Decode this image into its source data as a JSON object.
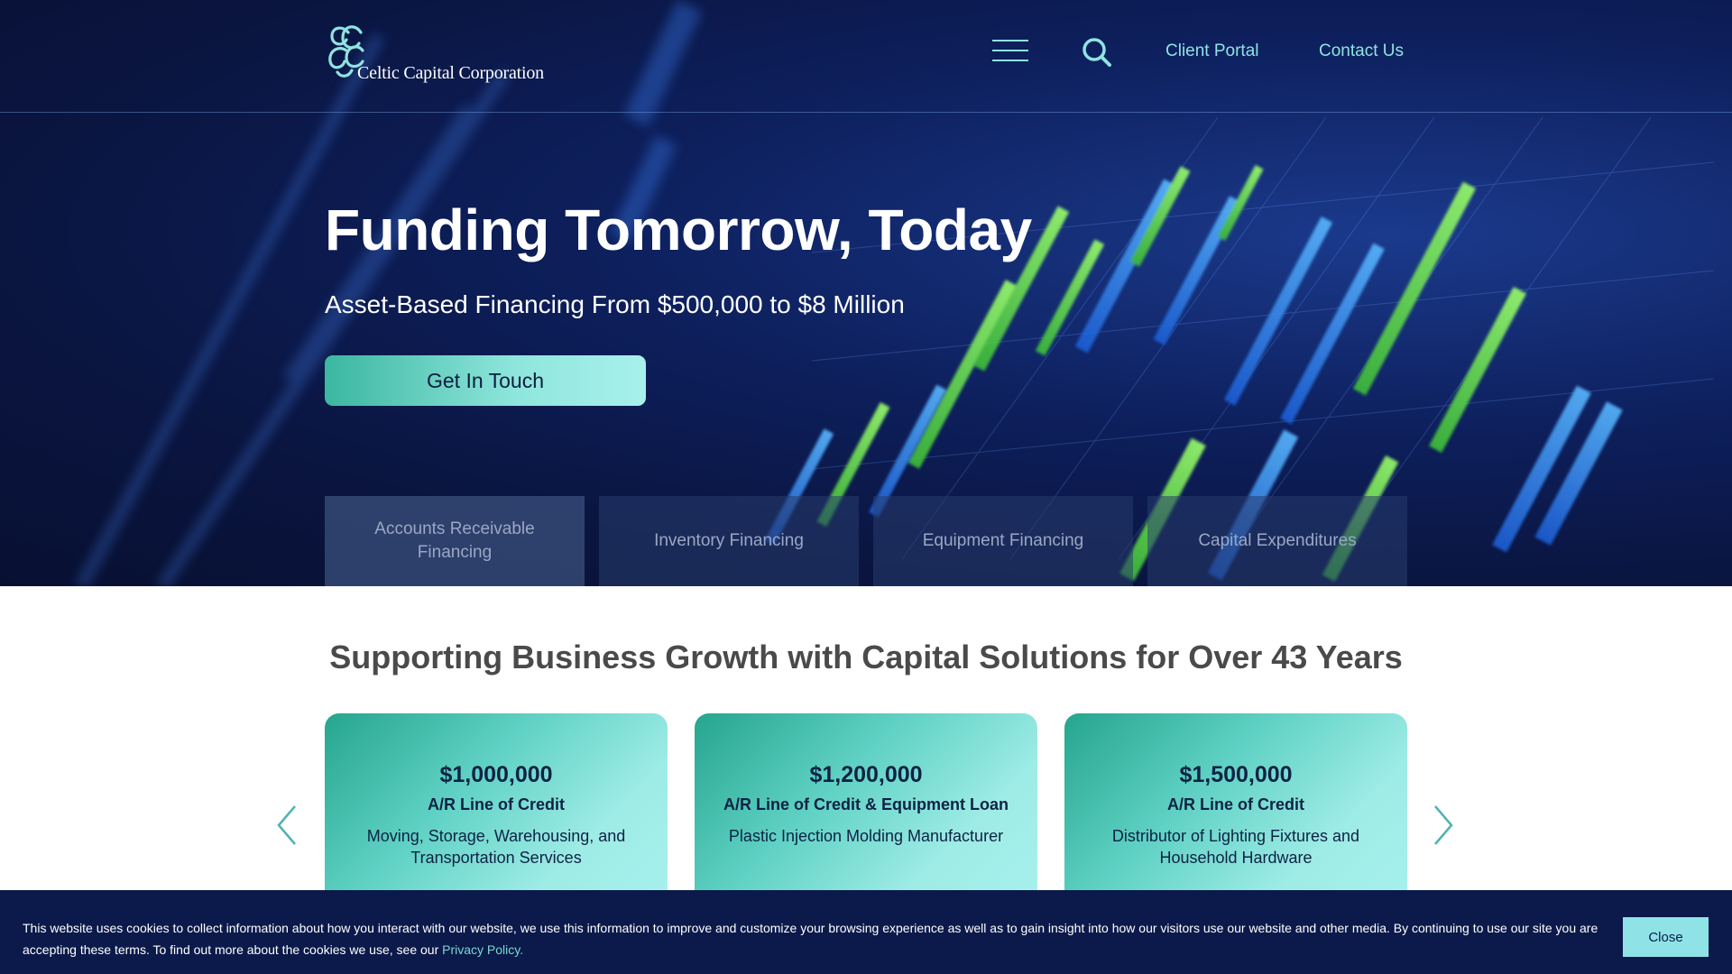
{
  "header": {
    "logo_text": "Celtic Capital Corporation",
    "menu_icon": "hamburger-menu-icon",
    "search_icon": "search-icon",
    "nav": [
      {
        "label": "Client Portal"
      },
      {
        "label": "Contact Us"
      }
    ]
  },
  "hero": {
    "title": "Funding Tomorrow, Today",
    "subtitle": "Asset-Based Financing From $500,000 to $8 Million",
    "cta_label": "Get In Touch",
    "tabs": [
      {
        "label": "Accounts Receivable Financing"
      },
      {
        "label": "Inventory Financing"
      },
      {
        "label": "Equipment Financing"
      },
      {
        "label": "Capital Expenditures"
      }
    ]
  },
  "main": {
    "section_title": "Supporting Business Growth with Capital Solutions for Over 43 Years",
    "cards": [
      {
        "amount": "$1,000,000",
        "type": "A/R Line of Credit",
        "description": "Moving, Storage, Warehousing, and Transportation Services"
      },
      {
        "amount": "$1,200,000",
        "type": "A/R Line of Credit & Equipment Loan",
        "description": "Plastic Injection Molding Manufacturer"
      },
      {
        "amount": "$1,500,000",
        "type": "A/R Line of Credit",
        "description": "Distributor of Lighting Fixtures and Household Hardware"
      }
    ],
    "prev_icon": "chevron-left-icon",
    "next_icon": "chevron-right-icon"
  },
  "cookie": {
    "text": "This website uses cookies to collect information about how you interact with our website, we use this information to improve and customize your browsing experience as well as to gain insight into how our visitors use our website and other media. By continuing to use our site you are accepting these terms. To find out more about the cookies we use, see our ",
    "link_label": "Privacy Policy.",
    "close_label": "Close"
  },
  "colors": {
    "accent": "#8fe3e1",
    "hero_bg": "#0d1f5c",
    "card_start": "#25a58e",
    "card_end": "#a6f0ec",
    "cookie_bg": "#0b1a4a"
  }
}
